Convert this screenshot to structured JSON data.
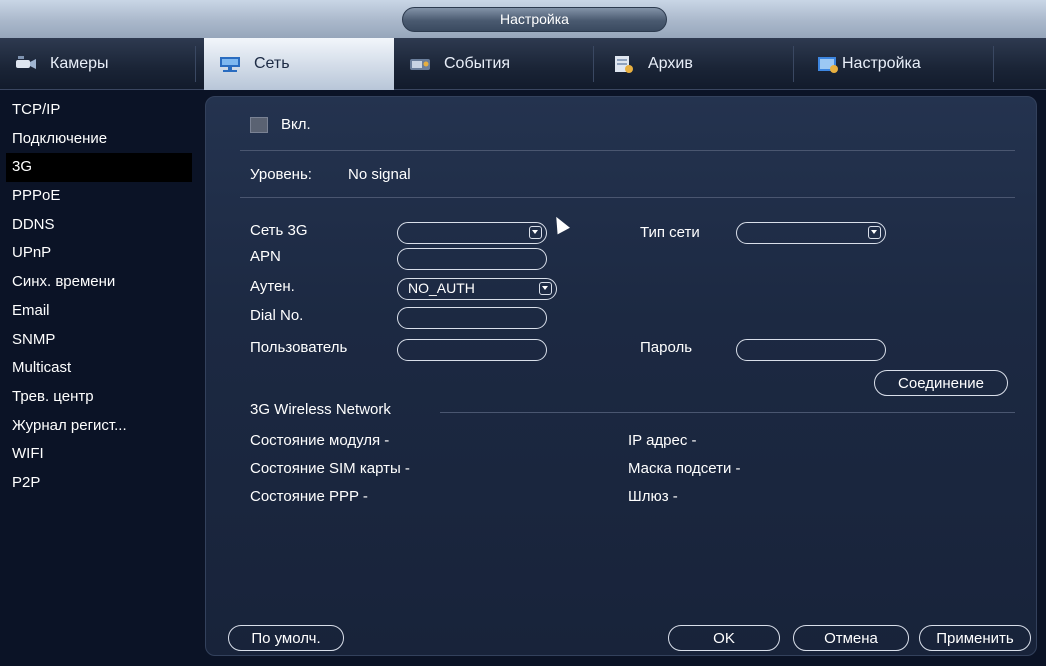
{
  "window": {
    "title": "Настройка"
  },
  "tabs": [
    {
      "label": "Камеры",
      "icon": "camera-icon",
      "active": false
    },
    {
      "label": "Сеть",
      "icon": "network-icon",
      "active": true
    },
    {
      "label": "События",
      "icon": "events-icon",
      "active": false
    },
    {
      "label": "Архив",
      "icon": "archive-icon",
      "active": false
    },
    {
      "label": "Настройка",
      "icon": "settings-icon",
      "active": false
    }
  ],
  "sidebar": {
    "items": [
      {
        "label": "TCP/IP"
      },
      {
        "label": "Подключение"
      },
      {
        "label": "3G",
        "active": true
      },
      {
        "label": "PPPoE"
      },
      {
        "label": "DDNS"
      },
      {
        "label": "UPnP"
      },
      {
        "label": "Синх. времени"
      },
      {
        "label": "Email"
      },
      {
        "label": "SNMP"
      },
      {
        "label": "Multicast"
      },
      {
        "label": "Трев. центр"
      },
      {
        "label": "Журнал регист..."
      },
      {
        "label": "WIFI"
      },
      {
        "label": "P2P"
      }
    ]
  },
  "form": {
    "enable_label": "Вкл.",
    "enable_checked": false,
    "level_label": "Уровень:",
    "level_value": "No signal",
    "net3g_label": "Сеть 3G",
    "net3g_value": "",
    "net_type_label": "Тип сети",
    "net_type_value": "",
    "apn_label": "APN",
    "apn_value": "",
    "auth_label": "Аутен.",
    "auth_value": "NO_AUTH",
    "dial_label": "Dial No.",
    "dial_value": "",
    "user_label": "Пользователь",
    "user_value": "",
    "password_label": "Пароль",
    "password_value": "",
    "connect_button": "Соединение"
  },
  "status": {
    "section_title": "3G Wireless Network",
    "module_state": "Состояние модуля -",
    "sim_state": "Состояние SIM карты -",
    "ppp_state": "Состояние PPP -",
    "ip_address": "IP адрес -",
    "subnet_mask": "Маска подсети -",
    "gateway": "Шлюз -"
  },
  "footer": {
    "default_button": "По умолч.",
    "ok_button": "OK",
    "cancel_button": "Отмена",
    "apply_button": "Применить"
  },
  "colors": {
    "background": "#0b1326",
    "panel": "#1c2942",
    "active_tab": "#cfd9e6",
    "sidebar_active": "#000000",
    "titlebar": "#aab8cb"
  }
}
